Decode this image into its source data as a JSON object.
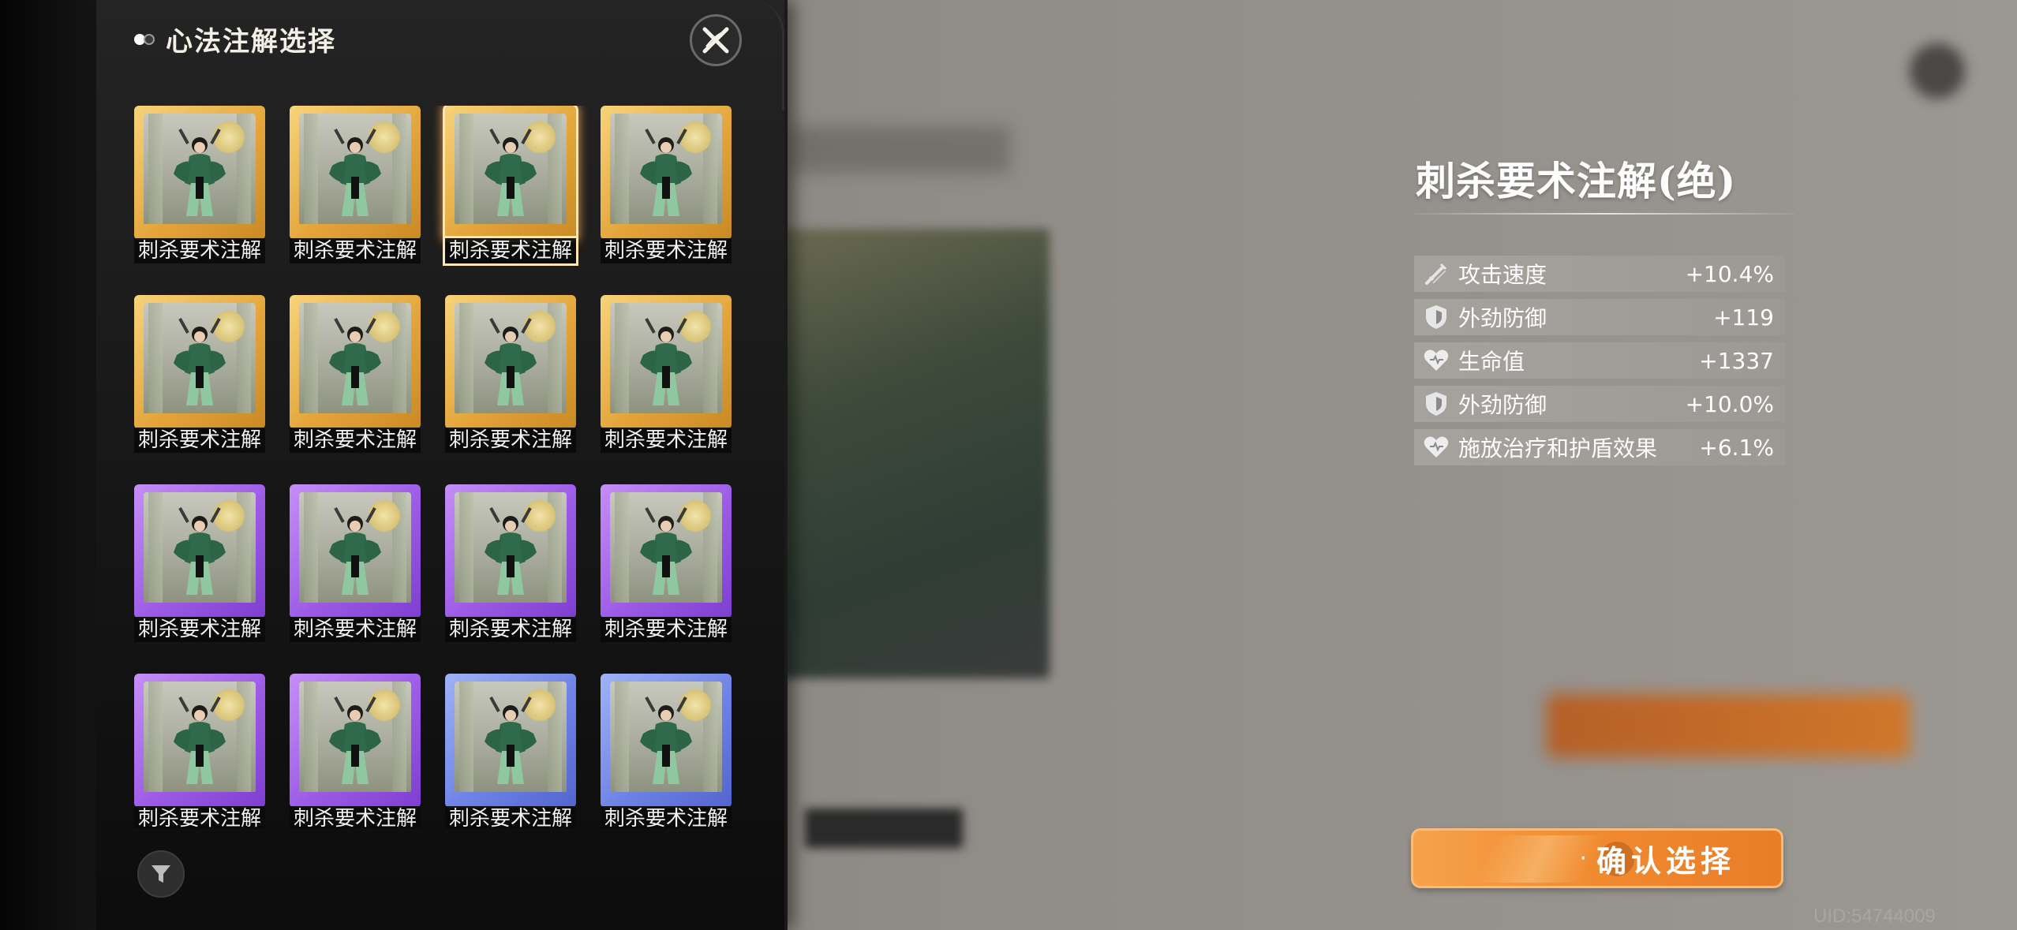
{
  "panel": {
    "title": "心法注解选择"
  },
  "cards": [
    {
      "label": "刺杀要术注解",
      "rarity": "gold",
      "selected": false
    },
    {
      "label": "刺杀要术注解",
      "rarity": "gold",
      "selected": false
    },
    {
      "label": "刺杀要术注解",
      "rarity": "gold",
      "selected": true
    },
    {
      "label": "刺杀要术注解",
      "rarity": "gold",
      "selected": false
    },
    {
      "label": "刺杀要术注解",
      "rarity": "gold",
      "selected": false
    },
    {
      "label": "刺杀要术注解",
      "rarity": "gold",
      "selected": false
    },
    {
      "label": "刺杀要术注解",
      "rarity": "gold",
      "selected": false
    },
    {
      "label": "刺杀要术注解",
      "rarity": "gold",
      "selected": false
    },
    {
      "label": "刺杀要术注解",
      "rarity": "purple",
      "selected": false
    },
    {
      "label": "刺杀要术注解",
      "rarity": "purple",
      "selected": false
    },
    {
      "label": "刺杀要术注解",
      "rarity": "purple",
      "selected": false
    },
    {
      "label": "刺杀要术注解",
      "rarity": "purple",
      "selected": false
    },
    {
      "label": "刺杀要术注解",
      "rarity": "purple",
      "selected": false
    },
    {
      "label": "刺杀要术注解",
      "rarity": "purple",
      "selected": false
    },
    {
      "label": "刺杀要术注解",
      "rarity": "blue",
      "selected": false
    },
    {
      "label": "刺杀要术注解",
      "rarity": "blue",
      "selected": false
    }
  ],
  "detail": {
    "title": "刺杀要术注解(绝)",
    "stats": [
      {
        "icon": "sword-icon",
        "name": "攻击速度",
        "value": "+10.4%"
      },
      {
        "icon": "shield-icon",
        "name": "外劲防御",
        "value": "+119"
      },
      {
        "icon": "heart-icon",
        "name": "生命值",
        "value": "+1337"
      },
      {
        "icon": "shield-icon",
        "name": "外劲防御",
        "value": "+10.0%"
      },
      {
        "icon": "heart-icon",
        "name": "施放治疗和护盾效果",
        "value": "+6.1%"
      }
    ]
  },
  "confirm": {
    "label": "确认选择",
    "dot": "·"
  },
  "uid": "UID:54744009",
  "colors": {
    "gold": "#e4a63b",
    "purple": "#9c5be6",
    "blue": "#6f83e6",
    "accent": "#f08a2f"
  }
}
